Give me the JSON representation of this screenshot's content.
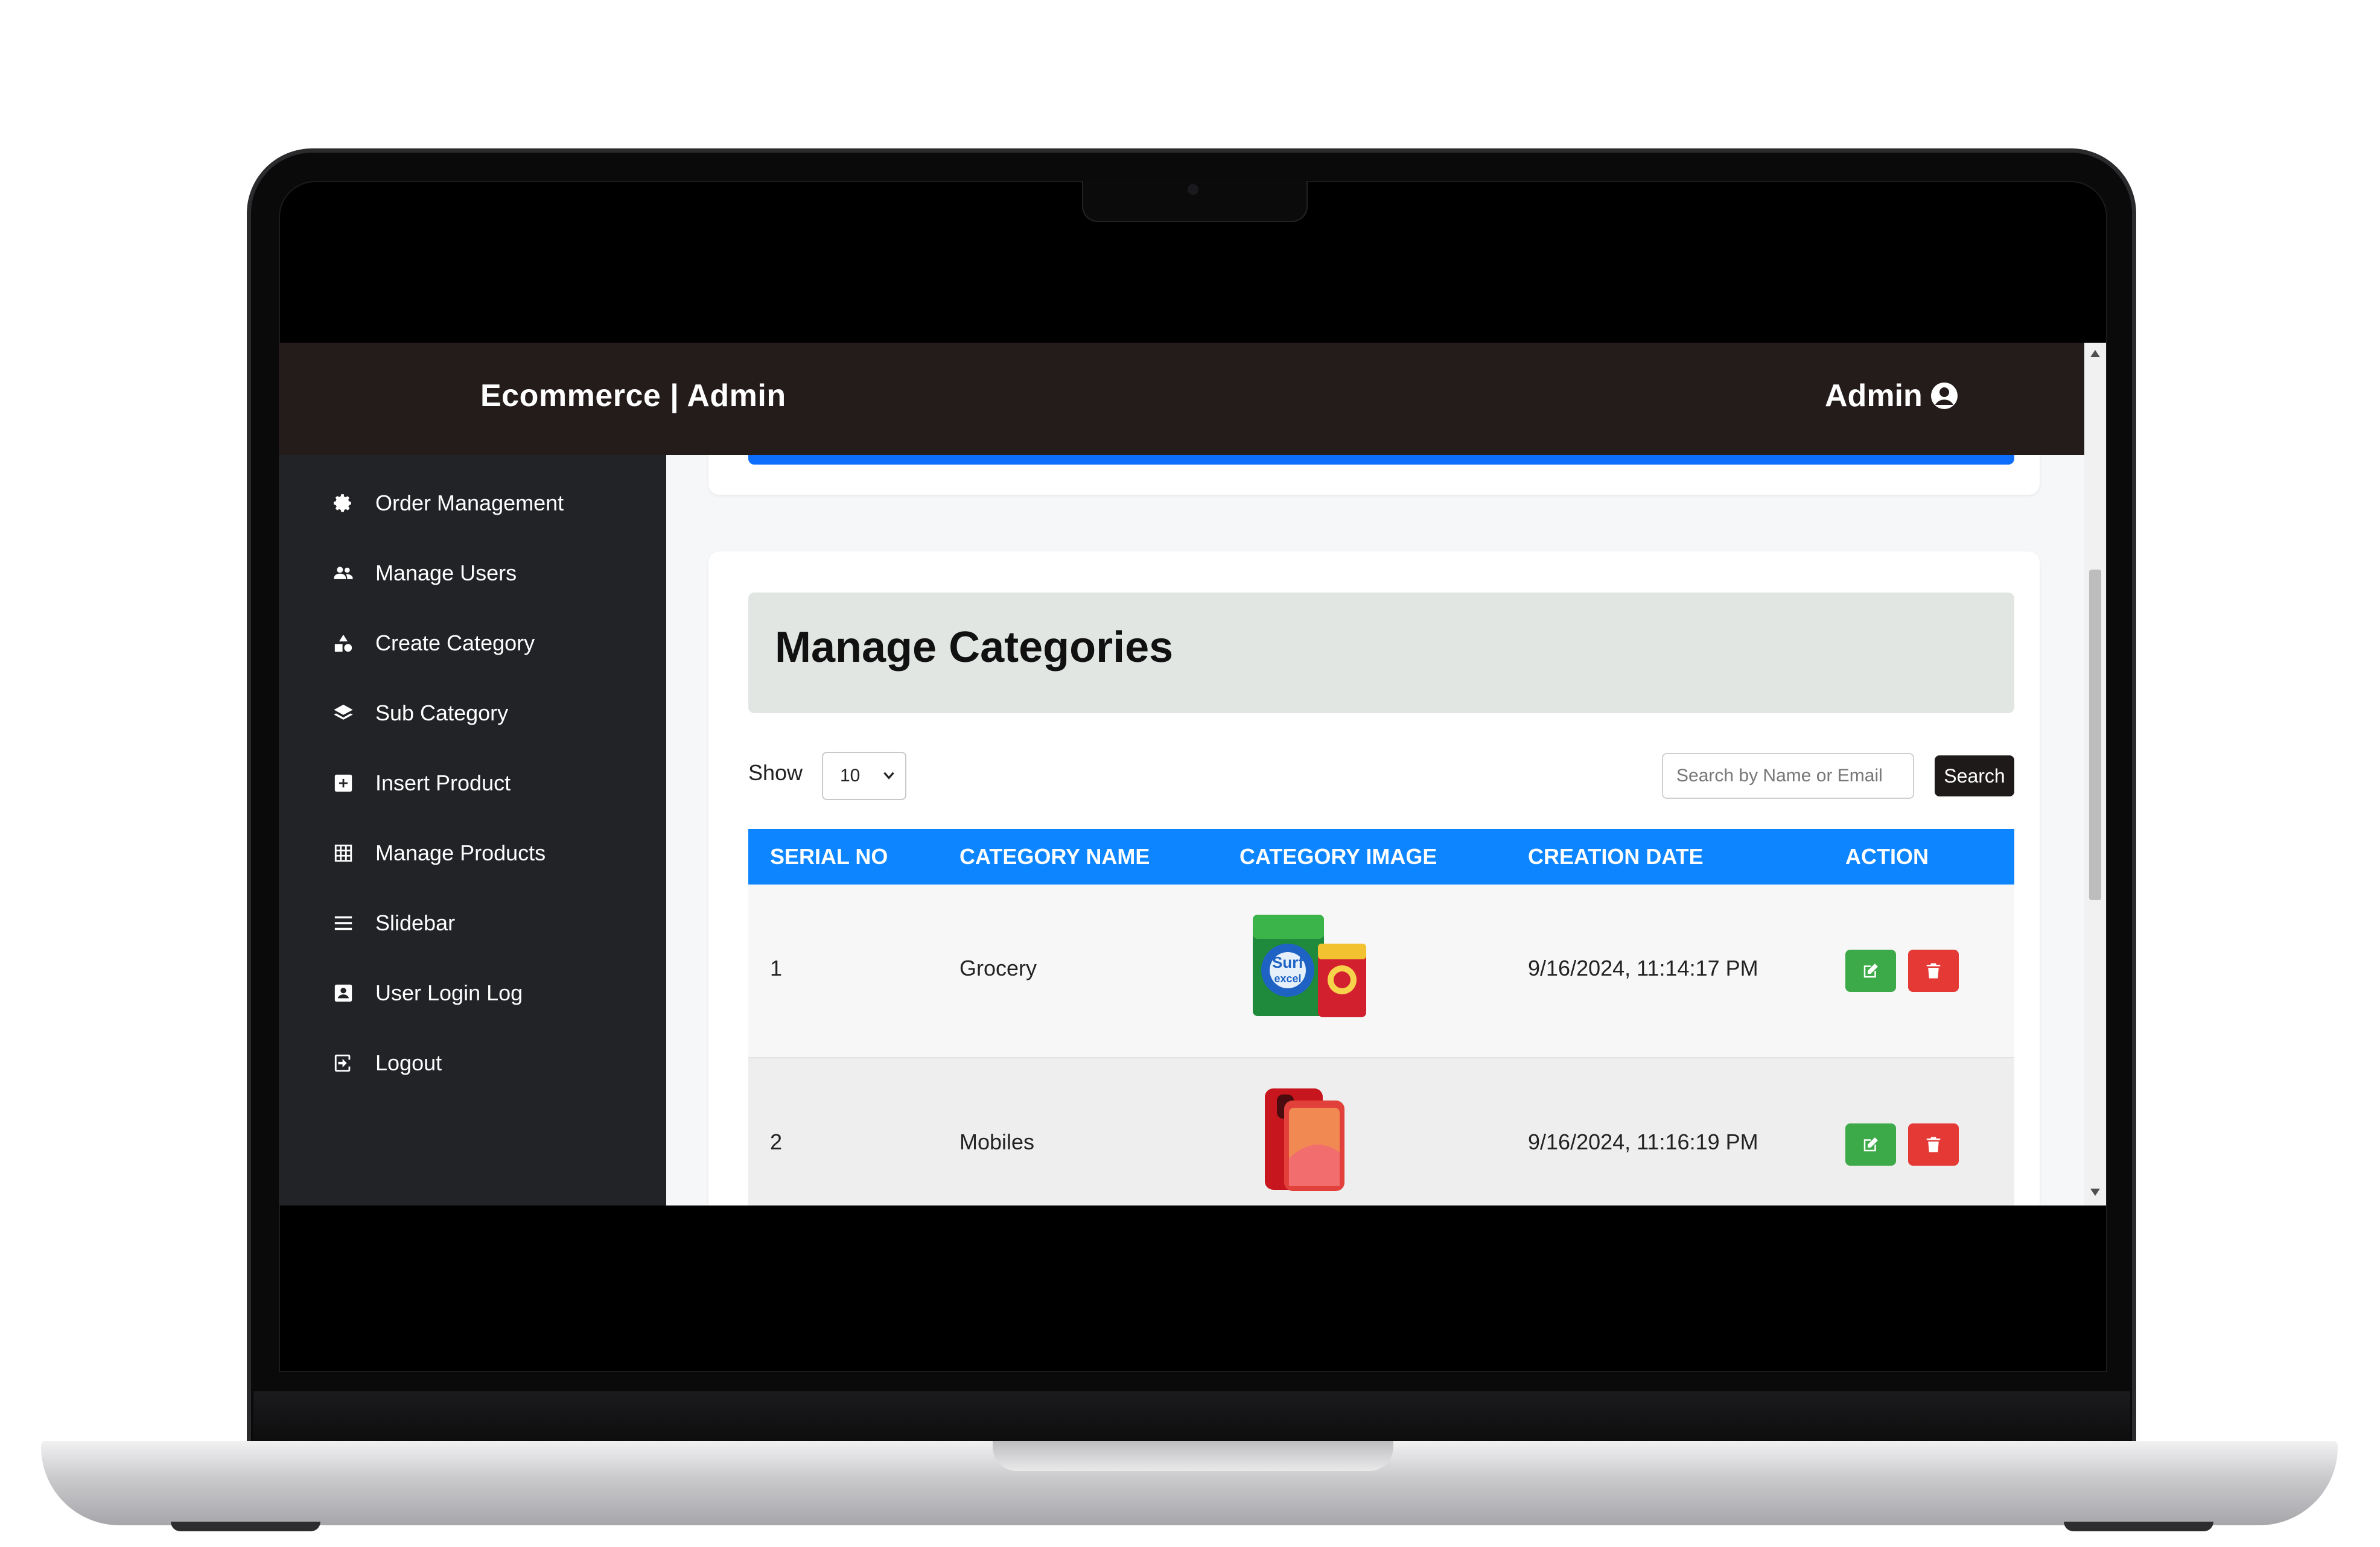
{
  "header": {
    "brand": "Ecommerce | Admin",
    "user_label": "Admin"
  },
  "sidebar": {
    "items": [
      {
        "label": "Order Management",
        "icon": "gear-icon"
      },
      {
        "label": "Manage Users",
        "icon": "users-icon"
      },
      {
        "label": "Create Category",
        "icon": "shapes-icon"
      },
      {
        "label": "Sub Category",
        "icon": "layers-icon"
      },
      {
        "label": "Insert Product",
        "icon": "plus-square-icon"
      },
      {
        "label": "Manage Products",
        "icon": "grid-icon"
      },
      {
        "label": "Slidebar",
        "icon": "menu-icon"
      },
      {
        "label": "User Login Log",
        "icon": "id-badge-icon"
      },
      {
        "label": "Logout",
        "icon": "logout-icon"
      }
    ]
  },
  "page": {
    "title": "Manage Categories"
  },
  "controls": {
    "show_label": "Show",
    "show_value": "10",
    "search_placeholder": "Search by Name or Email",
    "search_button": "Search"
  },
  "table": {
    "headers": [
      "SERIAL NO",
      "CATEGORY NAME",
      "CATEGORY IMAGE",
      "CREATION DATE",
      "ACTION"
    ],
    "rows": [
      {
        "serial": "1",
        "name": "Grocery",
        "image": "grocery-products-image",
        "date": "9/16/2024, 11:14:17 PM"
      },
      {
        "serial": "2",
        "name": "Mobiles",
        "image": "mobile-phone-image",
        "date": "9/16/2024, 11:16:19 PM"
      }
    ]
  },
  "colors": {
    "topbar": "#241b1b",
    "sidebar": "#212327",
    "table_header": "#0d85ff",
    "edit_button": "#3daa49",
    "delete_button": "#e53935"
  }
}
